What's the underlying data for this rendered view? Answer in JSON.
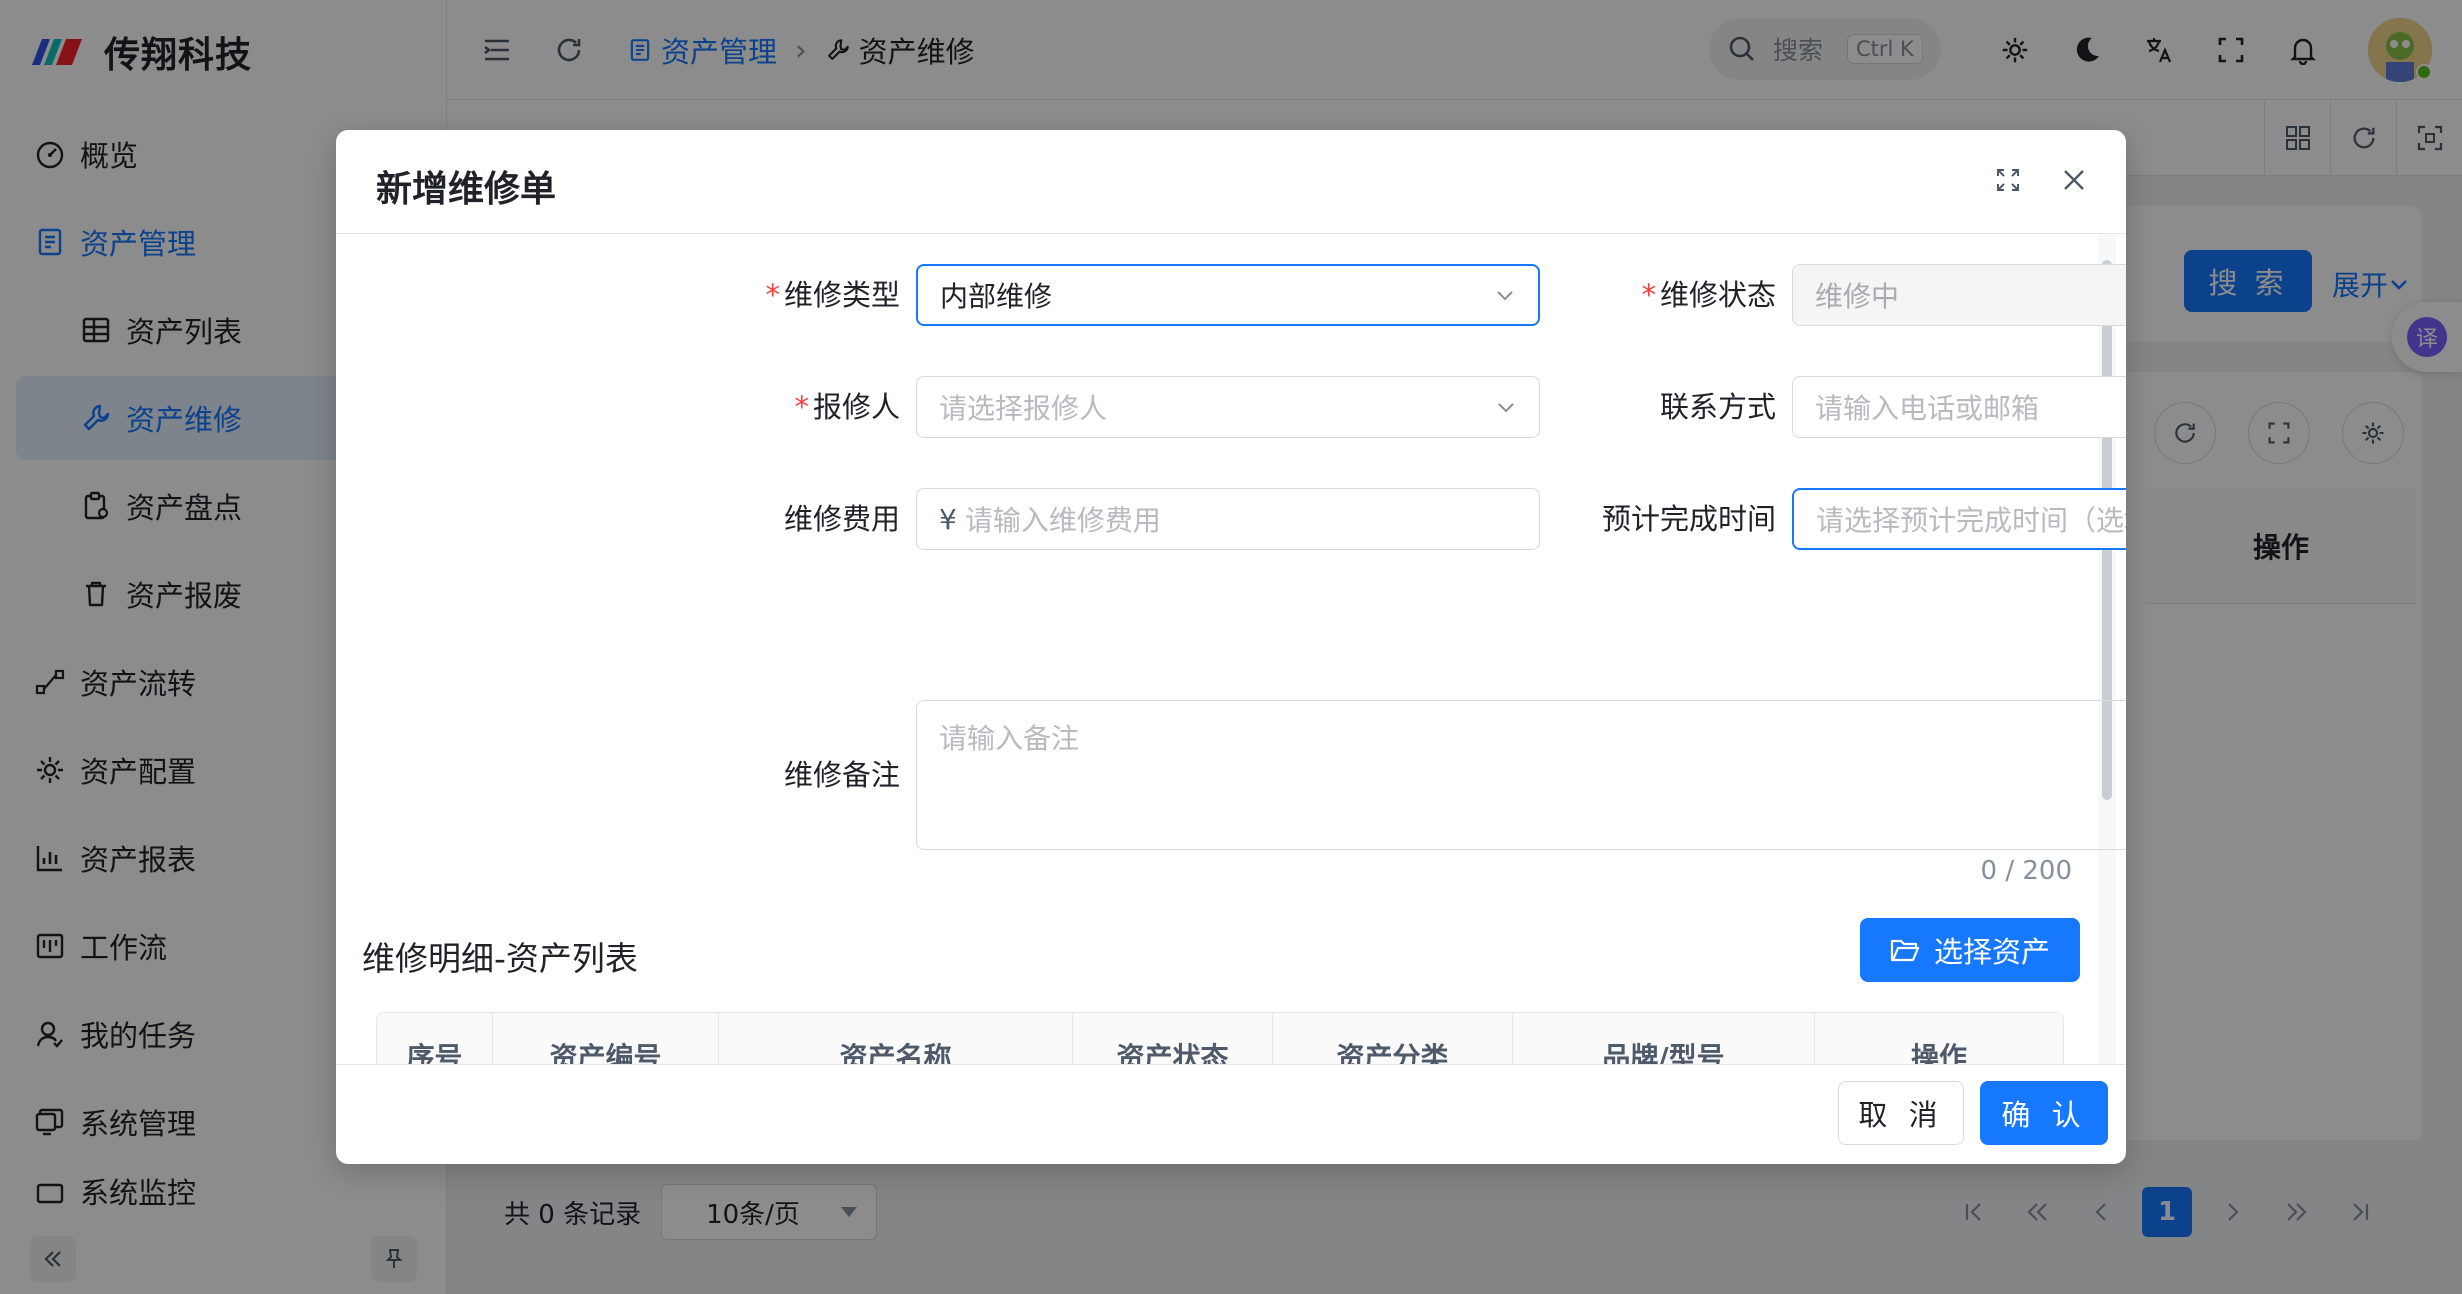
{
  "app": {
    "brand_name": "传翔科技"
  },
  "sidebar": {
    "items": [
      {
        "label": "概览",
        "icon": "dashboard-icon"
      },
      {
        "label": "资产管理",
        "icon": "document-icon"
      },
      {
        "label": "资产列表",
        "icon": "table-icon"
      },
      {
        "label": "资产维修",
        "icon": "wrench-icon"
      },
      {
        "label": "资产盘点",
        "icon": "clipboard-icon"
      },
      {
        "label": "资产报废",
        "icon": "trash-icon"
      },
      {
        "label": "资产流转",
        "icon": "flow-icon"
      },
      {
        "label": "资产配置",
        "icon": "gear-icon"
      },
      {
        "label": "资产报表",
        "icon": "bar-chart-icon"
      },
      {
        "label": "工作流",
        "icon": "workflow-icon"
      },
      {
        "label": "我的任务",
        "icon": "user-task-icon"
      },
      {
        "label": "系统管理",
        "icon": "monitor-icon"
      },
      {
        "label": "系统监控",
        "icon": "monitor-icon"
      }
    ]
  },
  "header": {
    "breadcrumb": [
      "资产管理",
      "资产维修"
    ],
    "search_placeholder": "搜索",
    "search_shortcut": "Ctrl K"
  },
  "background": {
    "search_button": "搜 索",
    "expand_label": "展开",
    "operation_header": "操作",
    "translate_fab": "译"
  },
  "pagination": {
    "total_text": "共 0 条记录",
    "page_size": "10条/页",
    "current_page": "1"
  },
  "modal": {
    "title": "新增维修单",
    "fields": {
      "repair_type": {
        "label": "维修类型",
        "value": "内部维修"
      },
      "repair_status": {
        "label": "维修状态",
        "value": "维修中"
      },
      "reporter": {
        "label": "报修人",
        "placeholder": "请选择报修人"
      },
      "contact": {
        "label": "联系方式",
        "placeholder": "请输入电话或邮箱"
      },
      "cost": {
        "label": "维修费用",
        "prefix": "¥",
        "placeholder": "请输入维修费用"
      },
      "eta": {
        "label": "预计完成时间",
        "placeholder": "请选择预计完成时间（选填）"
      },
      "remark": {
        "label": "维修备注",
        "placeholder": "请输入备注",
        "counter": "0 / 200"
      }
    },
    "section_title": "维修明细-资产列表",
    "select_asset_button": "选择资产",
    "table_columns": [
      "序号",
      "资产编号",
      "资产名称",
      "资产状态",
      "资产分类",
      "品牌/型号",
      "操作"
    ],
    "cancel_button": "取 消",
    "confirm_button": "确 认"
  },
  "colors": {
    "primary": "#1677ff",
    "required": "#f53f3f",
    "mask": "rgba(0,0,0,0.45)"
  }
}
